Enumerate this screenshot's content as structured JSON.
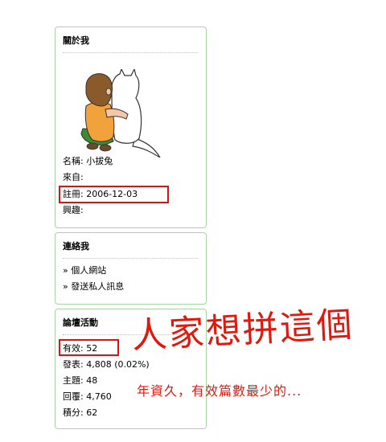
{
  "about": {
    "title": "關於我",
    "name_row": "名稱: 小拔兔",
    "from_row": "來自:",
    "register_row": "註冊: 2006-12-03",
    "interest_row": "興趣:"
  },
  "contact": {
    "title": "連絡我",
    "links": [
      "» 個人網站",
      "» 發送私人訊息"
    ]
  },
  "activity": {
    "title": "論壇活動",
    "valid_row": "有效: 52",
    "posts_row": "發表: 4,808 (0.02%)",
    "topics_row": "主題: 48",
    "replies_row": "回覆: 4,760",
    "points_row": "積分: 62"
  },
  "annotation": {
    "handwritten": "人家想拼這個",
    "note": "年資久，有效篇數最少的..."
  },
  "colors": {
    "box_border": "#a9d4a6",
    "annotation_red": "#e0190f"
  },
  "icons": {
    "avatar": "girl-and-cat-avatar"
  }
}
